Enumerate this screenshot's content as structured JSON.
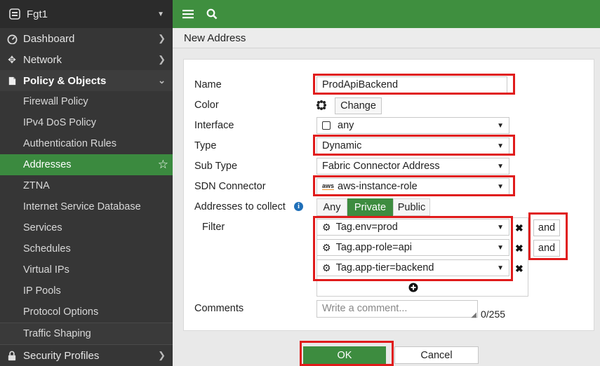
{
  "sidebar": {
    "device_name": "Fgt1",
    "nav": [
      {
        "label": "Dashboard",
        "icon": "dashboard-icon"
      },
      {
        "label": "Network",
        "icon": "network-icon"
      },
      {
        "label": "Policy & Objects",
        "icon": "policy-icon"
      }
    ],
    "sub_items": [
      "Firewall Policy",
      "IPv4 DoS Policy",
      "Authentication Rules",
      "Addresses",
      "ZTNA",
      "Internet Service Database",
      "Services",
      "Schedules",
      "Virtual IPs",
      "IP Pools",
      "Protocol Options",
      "Traffic Shaping"
    ],
    "bottom_nav": {
      "label": "Security Profiles",
      "icon": "lock-icon"
    }
  },
  "page": {
    "title": "New Address"
  },
  "form": {
    "labels": {
      "name": "Name",
      "color": "Color",
      "interface": "Interface",
      "type": "Type",
      "sub_type": "Sub Type",
      "sdn_connector": "SDN Connector",
      "addresses_to_collect": "Addresses to collect",
      "filter": "Filter",
      "comments": "Comments"
    },
    "name_value": "ProdApiBackend",
    "color_button": "Change",
    "interface_value": "any",
    "type_value": "Dynamic",
    "sub_type_value": "Fabric Connector Address",
    "sdn_connector_value": "aws-instance-role",
    "sdn_connector_badge": "aws",
    "collect_options": [
      "Any",
      "Private",
      "Public"
    ],
    "collect_selected": "Private",
    "filters": [
      "Tag.env=prod",
      "Tag.app-role=api",
      "Tag.app-tier=backend"
    ],
    "and_labels": [
      "and",
      "and"
    ],
    "comments_placeholder": "Write a comment...",
    "comments_counter": "0/255"
  },
  "footer": {
    "ok_label": "OK",
    "cancel_label": "Cancel"
  },
  "colors": {
    "accent_green": "#3f8f3f",
    "highlight_red": "#e01b1b",
    "sidebar_bg": "#363636"
  }
}
